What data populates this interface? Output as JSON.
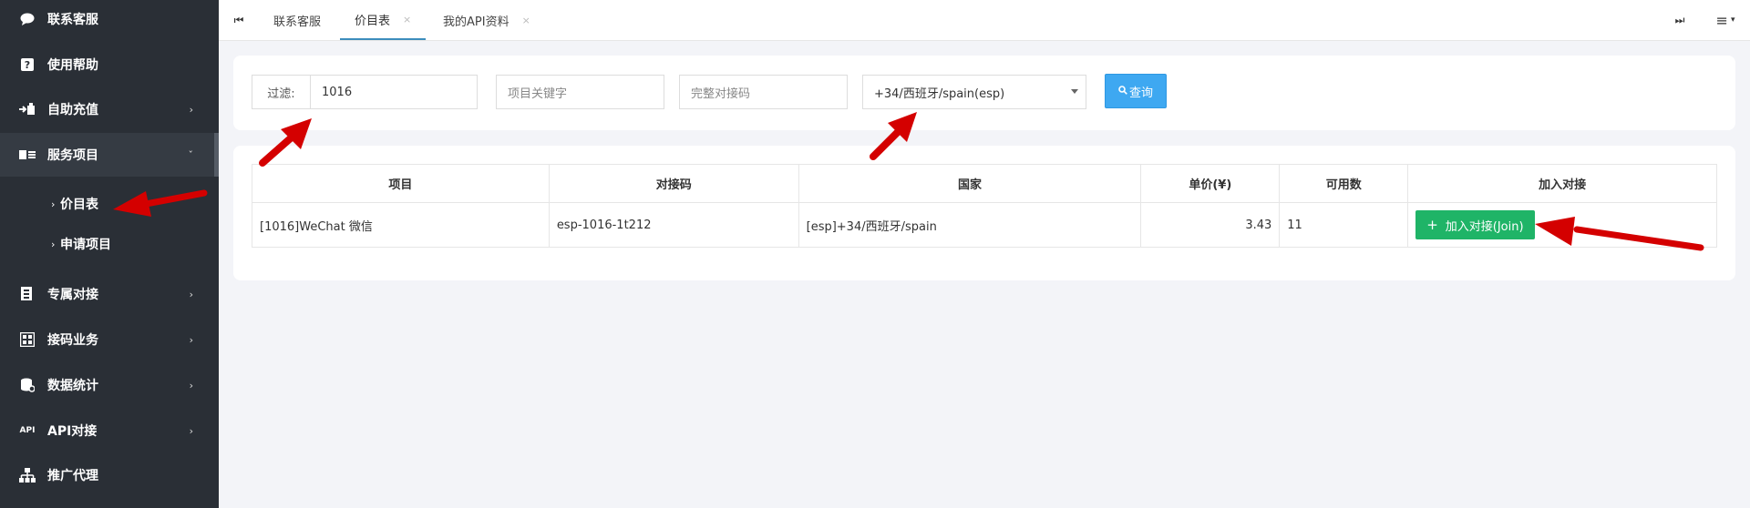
{
  "sidebar": {
    "items": [
      {
        "label": "联系客服",
        "icon": "chat-bubble-icon",
        "glyph": "💬"
      },
      {
        "label": "使用帮助",
        "icon": "help-icon",
        "glyph": "?"
      },
      {
        "label": "自助充值",
        "icon": "recharge-icon",
        "glyph": "⇨"
      },
      {
        "label": "服务项目",
        "icon": "id-card-icon",
        "glyph": "▤"
      },
      {
        "label": "专属对接",
        "icon": "document-icon",
        "glyph": "▦"
      },
      {
        "label": "接码业务",
        "icon": "calculator-icon",
        "glyph": "▣"
      },
      {
        "label": "数据统计",
        "icon": "database-icon",
        "glyph": "⛁"
      },
      {
        "label": "API对接",
        "icon": "api-icon",
        "glyph": "API"
      },
      {
        "label": "推广代理",
        "icon": "sitemap-icon",
        "glyph": "⚙"
      }
    ],
    "sub_items": [
      {
        "label": "价目表"
      },
      {
        "label": "申请项目"
      }
    ]
  },
  "topbar": {
    "first_icon": "⏮",
    "last_icon": "⏭",
    "menu_icon": "≡",
    "tabs": [
      {
        "label": "联系客服"
      },
      {
        "label": "价目表",
        "close": "×"
      },
      {
        "label": "我的API资料",
        "close": "×"
      }
    ]
  },
  "filter": {
    "label": "过滤:",
    "value": "1016",
    "keyword_placeholder": "项目关键字",
    "code_placeholder": "完整对接码",
    "country_selected": "+34/西班牙/spain(esp)",
    "query_button": "查询",
    "query_icon": "🔍"
  },
  "table": {
    "headers": [
      "项目",
      "对接码",
      "国家",
      "单价(¥)",
      "可用数",
      "加入对接"
    ],
    "rows": [
      {
        "project": "[1016]WeChat 微信",
        "code": "esp-1016-1t212",
        "country": "[esp]+34/西班牙/spain",
        "price": "3.43",
        "available": "11",
        "action": "加入对接(Join)",
        "action_icon": "+"
      }
    ]
  },
  "colors": {
    "sidebar_bg": "#2a2f36",
    "accent_blue": "#3ea8f1",
    "join_green": "#1fb467",
    "price_green": "#1e8a1e",
    "annotation_red": "#d40000"
  }
}
